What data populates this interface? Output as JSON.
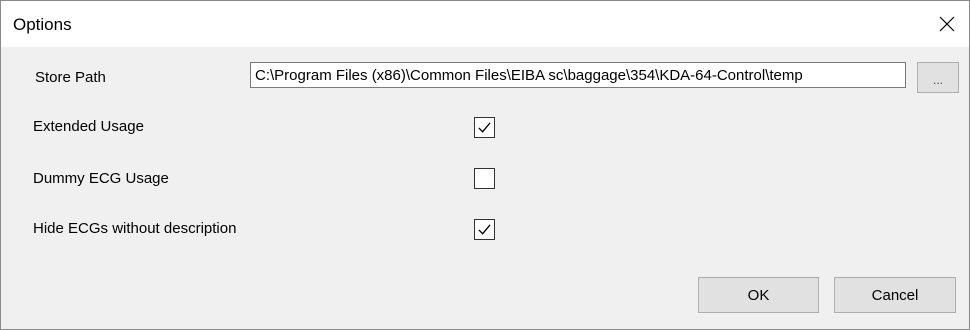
{
  "window": {
    "title": "Options"
  },
  "icons": {
    "close": "close-icon",
    "check": "checkmark-icon"
  },
  "store_path": {
    "label": "Store Path",
    "value": "C:\\Program Files (x86)\\Common Files\\EIBA sc\\baggage\\354\\KDA-64-Control\\temp",
    "browse_label": "..."
  },
  "options": [
    {
      "label": "Extended Usage",
      "checked": true
    },
    {
      "label": "Dummy ECG Usage",
      "checked": false
    },
    {
      "label": "Hide ECGs without description",
      "checked": true
    }
  ],
  "buttons": {
    "ok": "OK",
    "cancel": "Cancel"
  },
  "colors": {
    "background": "#f0f0f0",
    "titlebar": "#ffffff",
    "button": "#e1e1e1"
  }
}
